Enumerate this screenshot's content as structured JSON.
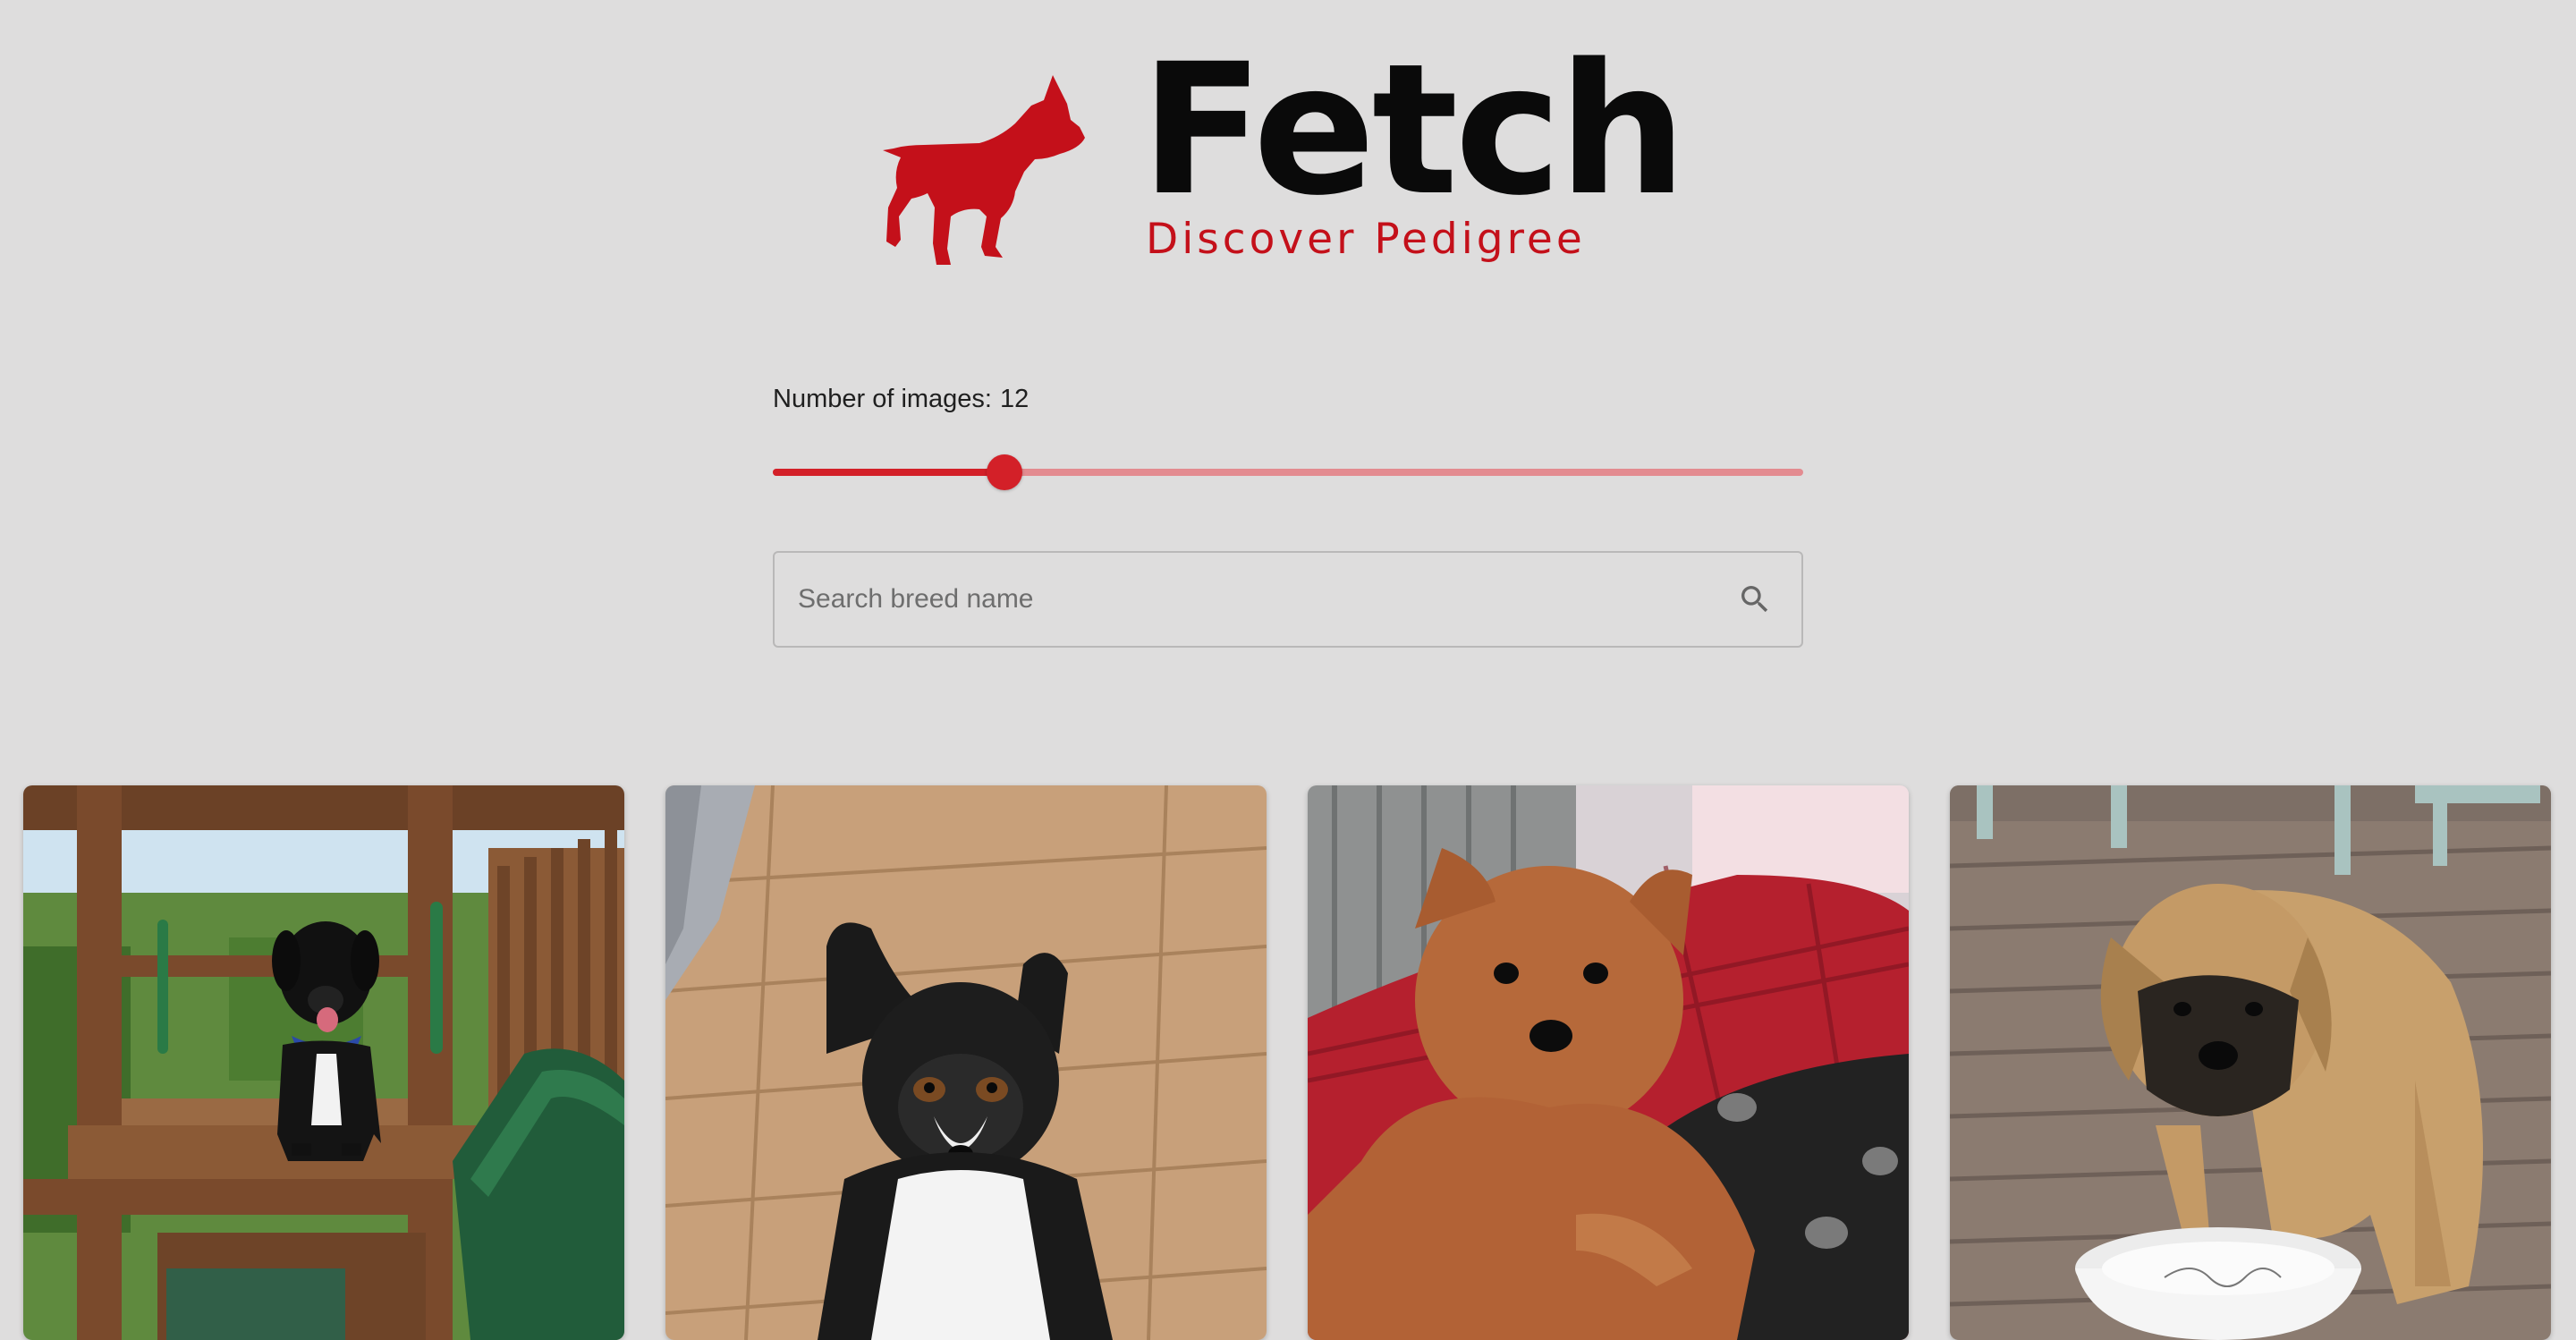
{
  "brand": {
    "title": "Fetch",
    "subtitle": "Discover Pedigree",
    "accent_color": "#c4101a"
  },
  "slider": {
    "label": "Number of images:",
    "value": 12,
    "value_text": "12",
    "fraction": 0.225
  },
  "search": {
    "placeholder": "Search breed name",
    "value": "",
    "icon": "search-icon"
  },
  "images": [
    {
      "name": "dog-image-1"
    },
    {
      "name": "dog-image-2"
    },
    {
      "name": "dog-image-3"
    },
    {
      "name": "dog-image-4"
    }
  ]
}
